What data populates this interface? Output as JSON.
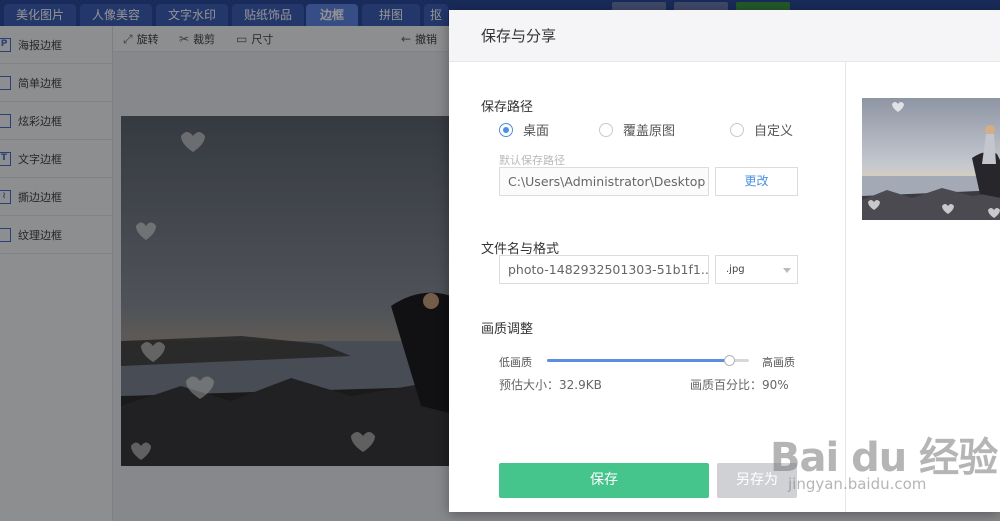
{
  "topbar": {
    "tabs": [
      {
        "label": "美化图片",
        "active": false
      },
      {
        "label": "人像美容",
        "active": false
      },
      {
        "label": "文字水印",
        "active": false
      },
      {
        "label": "贴纸饰品",
        "active": false
      },
      {
        "label": "边框",
        "active": true
      },
      {
        "label": "拼图",
        "active": false
      },
      {
        "label": "抠",
        "active": false
      }
    ]
  },
  "sidebar": {
    "items": [
      {
        "label": "海报边框",
        "icon": "P"
      },
      {
        "label": "简单边框",
        "icon": ""
      },
      {
        "label": "炫彩边框",
        "icon": ""
      },
      {
        "label": "文字边框",
        "icon": "T"
      },
      {
        "label": "撕边边框",
        "icon": "≀"
      },
      {
        "label": "纹理边框",
        "icon": ""
      }
    ]
  },
  "toolbar": {
    "rotate_label": "旋转",
    "crop_label": "裁剪",
    "size_label": "尺寸",
    "undo_label": "撤销"
  },
  "dialog": {
    "title": "保存与分享",
    "path_section_title": "保存路径",
    "radios": [
      {
        "label": "桌面",
        "checked": true
      },
      {
        "label": "覆盖原图",
        "checked": false
      },
      {
        "label": "自定义",
        "checked": false
      }
    ],
    "default_path_hint": "默认保存路径",
    "path_value": "C:\\Users\\Administrator\\Desktop",
    "change_label": "更改",
    "filename_section_title": "文件名与格式",
    "filename_value": "photo-1482932501303-51b1f1...",
    "format_value": ".jpg",
    "quality_section_title": "画质调整",
    "low_quality_label": "低画质",
    "high_quality_label": "高画质",
    "quality_percent": 90,
    "estimated_size_text": "预估大小：32.9KB",
    "quality_percent_text": "画质百分比：90%",
    "save_label": "保存",
    "save_as_label": "另存为"
  },
  "watermark": {
    "brand_text": "Bai du 经验",
    "url_text": "jingyan.baidu.com"
  },
  "colors": {
    "accent_blue": "#4a90e2",
    "save_green": "#45c48c",
    "slider_blue": "#5b8de0",
    "topbar_blue": "#2b4a9c"
  }
}
